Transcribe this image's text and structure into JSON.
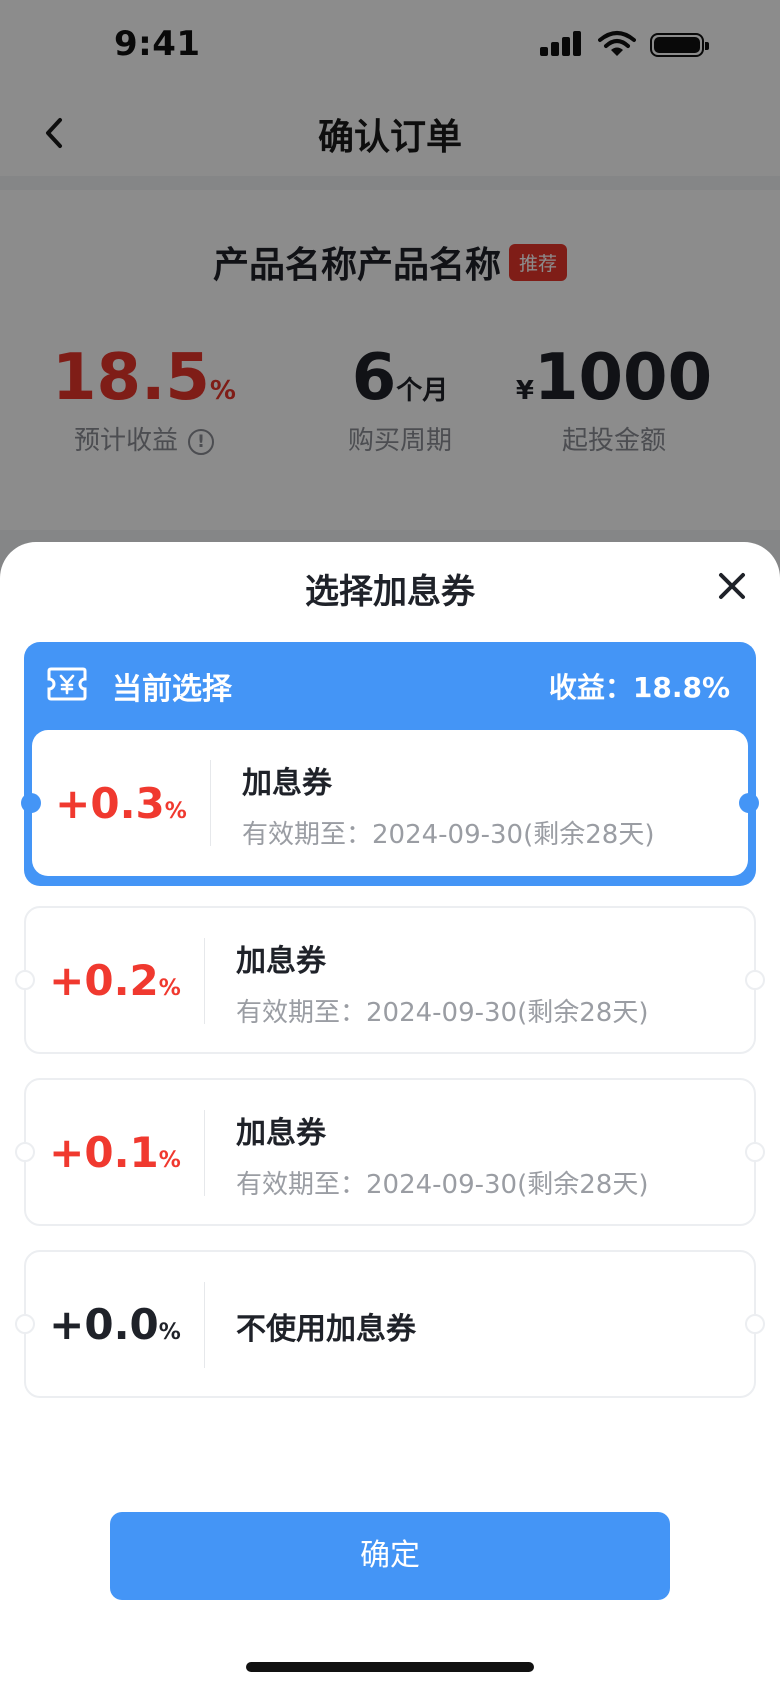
{
  "status_bar": {
    "time": "9:41"
  },
  "nav": {
    "title": "确认订单"
  },
  "product": {
    "name": "产品名称产品名称",
    "tag": "推荐",
    "stats": [
      {
        "value": "18.5",
        "unit": "%",
        "label": "预计收益"
      },
      {
        "value": "6",
        "unit": "个月",
        "label": "购买周期"
      },
      {
        "prefix": "¥",
        "value": "1000",
        "label": "起投金额"
      }
    ]
  },
  "sheet": {
    "title": "选择加息券",
    "selected": {
      "label": "当前选择",
      "yield": "收益：18.8%",
      "coupon": {
        "rate": "+0.3",
        "unit": "%",
        "name": "加息券",
        "expire": "有效期至：2024-09-30(剩余28天)"
      }
    },
    "coupons": [
      {
        "rate": "+0.2",
        "unit": "%",
        "name": "加息券",
        "expire": "有效期至：2024-09-30(剩余28天)"
      },
      {
        "rate": "+0.1",
        "unit": "%",
        "name": "加息券",
        "expire": "有效期至：2024-09-30(剩余28天)"
      },
      {
        "rate": "+0.0",
        "unit": "%",
        "name": "不使用加息券"
      }
    ],
    "confirm_label": "确定"
  },
  "colors": {
    "accent": "#4495f6",
    "rate_red": "#f0392f",
    "tag_red": "#e8352b"
  },
  "icons": {
    "back": "chevron-left-icon",
    "close": "close-icon",
    "coupon": "coupon-yen-icon",
    "info": "info-icon"
  }
}
